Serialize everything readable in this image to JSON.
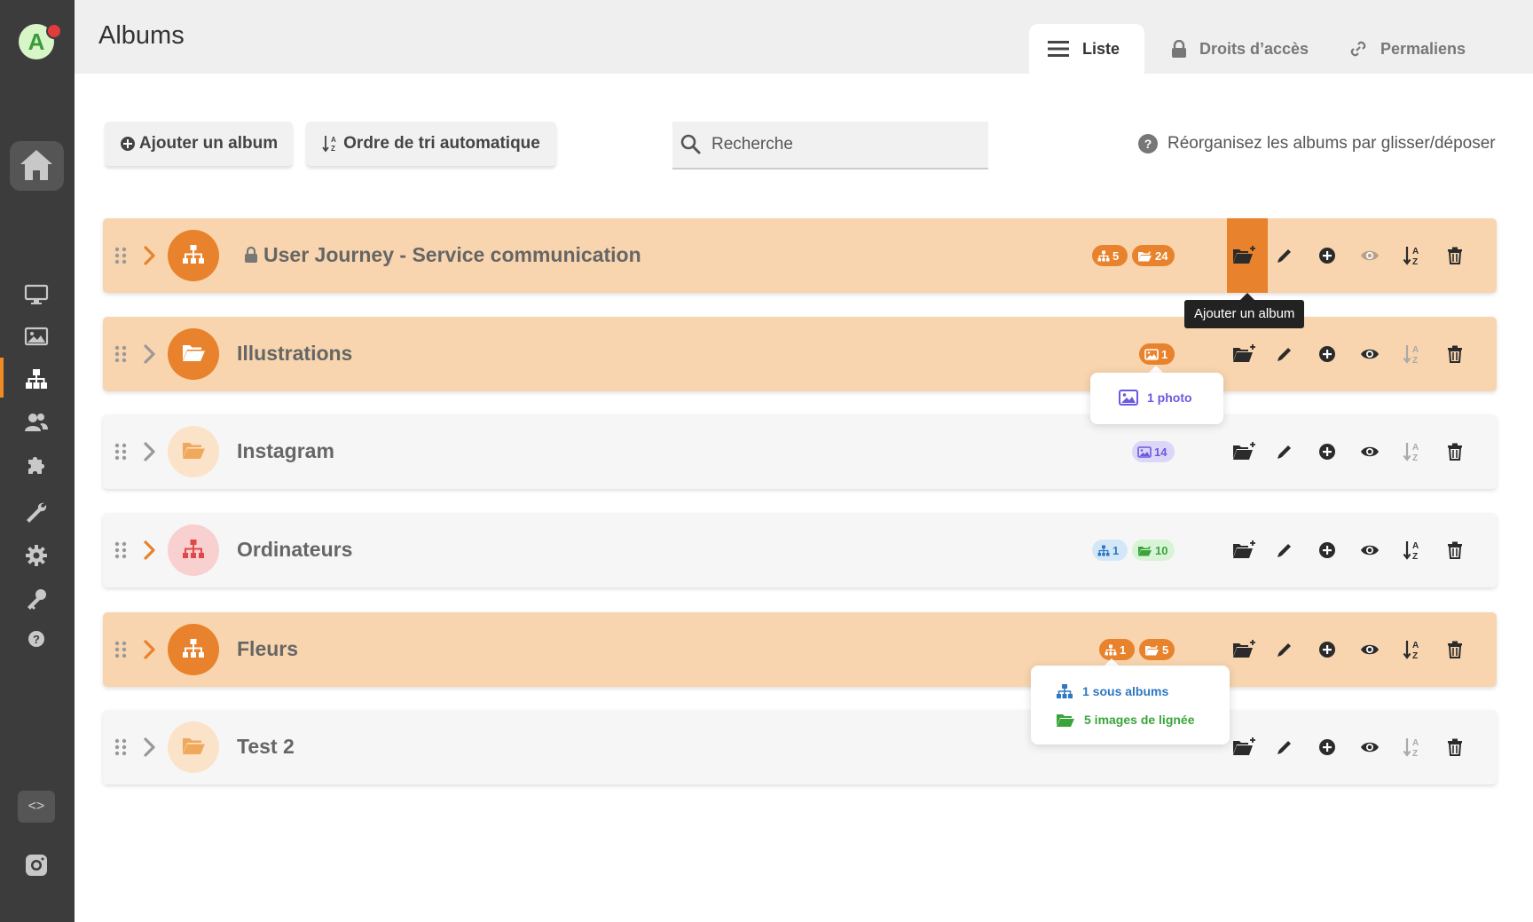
{
  "sidebar": {
    "avatar_letter": "A",
    "icons": [
      "home-icon",
      "monitor-icon",
      "image-icon",
      "sitemap-icon",
      "users-icon",
      "puzzle-icon",
      "wrench-icon",
      "gear-icon",
      "key-icon",
      "help-icon",
      "code-icon",
      "instagram-icon"
    ],
    "active_item": "sitemap-icon"
  },
  "header": {
    "title": "Albums",
    "tabs": [
      {
        "label": "Liste",
        "icon": "list-icon",
        "active": true
      },
      {
        "label": "Droits d’accès",
        "icon": "lock-icon",
        "active": false
      },
      {
        "label": "Permaliens",
        "icon": "link-icon",
        "active": false
      }
    ]
  },
  "toolbar": {
    "add_label": "Ajouter un album",
    "sort_label": "Ordre de tri automatique",
    "search_placeholder": "Recherche",
    "hint": "Réorganisez les albums par glisser/déposer"
  },
  "albums": [
    {
      "name": "User Journey - Service communication",
      "locked": true,
      "highlight": true,
      "icon": "sitemap-icon",
      "badges": [
        {
          "type": "subalbums",
          "value": "5"
        },
        {
          "type": "lineage",
          "value": "24"
        }
      ]
    },
    {
      "name": "Illustrations",
      "locked": false,
      "highlight": true,
      "icon": "folder-open-icon",
      "badges": [
        {
          "type": "photos",
          "value": "1"
        }
      ]
    },
    {
      "name": "Instagram",
      "locked": false,
      "highlight": false,
      "icon": "folder-open-icon",
      "badges": [
        {
          "type": "photos",
          "value": "14"
        }
      ]
    },
    {
      "name": "Ordinateurs",
      "locked": false,
      "highlight": false,
      "icon": "sitemap-icon",
      "badges": [
        {
          "type": "subalbums",
          "value": "1"
        },
        {
          "type": "lineage",
          "value": "10"
        }
      ]
    },
    {
      "name": "Fleurs",
      "locked": false,
      "highlight": true,
      "icon": "sitemap-icon",
      "badges": [
        {
          "type": "subalbums",
          "value": "1"
        },
        {
          "type": "lineage",
          "value": "5"
        }
      ]
    },
    {
      "name": "Test 2",
      "locked": false,
      "highlight": false,
      "icon": "folder-open-icon",
      "badges": []
    }
  ],
  "row_actions": [
    "add-subalbum-icon",
    "edit-icon",
    "add-photo-icon",
    "view-icon",
    "sort-icon",
    "delete-icon"
  ],
  "tooltips": {
    "add_album": "Ajouter un album",
    "photos": "1 photo",
    "subalbums": "1 sous albums",
    "lineage_images": "5 images de lignée"
  },
  "colors": {
    "accent": "#e8822c",
    "highlight_row": "#f8d5ae",
    "plain_row": "#f6f6f6",
    "sidebar": "#3c3c3c",
    "photos_badge": "#6a5ae0",
    "subalbum_badge": "#2d78c2",
    "lineage_badge": "#3aa43a"
  }
}
